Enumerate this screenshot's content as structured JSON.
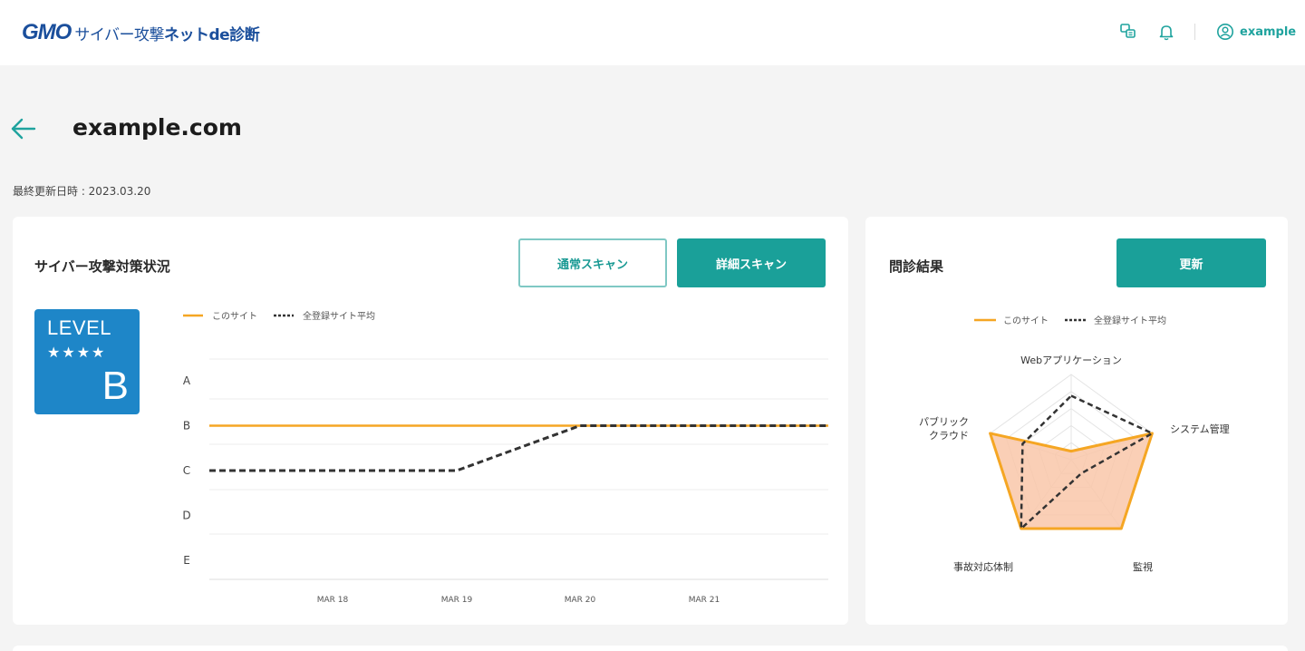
{
  "header": {
    "logo_brand": "GMO",
    "logo_regular": "サイバー攻撃",
    "logo_bold": "ネットde診断",
    "username": "example",
    "icons": [
      "notice-icon",
      "bell-icon",
      "user-icon"
    ]
  },
  "page": {
    "title": "example.com",
    "updated": "最終更新日時 : 2023.03.20"
  },
  "status_card": {
    "title": "サイバー攻撃対策状況",
    "normal_scan_label": "通常スキャン",
    "detail_scan_label": "詳細スキャン",
    "level": {
      "label": "LEVEL",
      "stars": "★★★★",
      "grade": "B"
    }
  },
  "result_card": {
    "title": "問診結果",
    "update_label": "更新"
  },
  "colors": {
    "accent": "#1aa099",
    "site_line": "#f5a623",
    "average_line": "#333333",
    "level_badge": "#1e86c8",
    "radar_fill": "#f9c7a9"
  },
  "chart_data": [
    {
      "type": "line",
      "legend": [
        "このサイト",
        "全登録サイト平均"
      ],
      "legend_position": "top-left",
      "y_categories": [
        "A",
        "B",
        "C",
        "D",
        "E"
      ],
      "x_ticks": [
        "MAR 18",
        "MAR 19",
        "MAR 20",
        "MAR 21"
      ],
      "grid": true,
      "series": [
        {
          "name": "このサイト",
          "style": "solid",
          "points": [
            [
              "MAR 17",
              "B"
            ],
            [
              "MAR 18",
              "B"
            ],
            [
              "MAR 19",
              "B"
            ],
            [
              "MAR 20",
              "B"
            ],
            [
              "MAR 21",
              "B"
            ],
            [
              "MAR 22",
              "B"
            ]
          ]
        },
        {
          "name": "全登録サイト平均",
          "style": "dashed",
          "points": [
            [
              "MAR 17",
              "C"
            ],
            [
              "MAR 18",
              "C"
            ],
            [
              "MAR 19",
              "C"
            ],
            [
              "MAR 20",
              "B"
            ],
            [
              "MAR 21",
              "B"
            ],
            [
              "MAR 22",
              "B"
            ]
          ]
        }
      ]
    },
    {
      "type": "radar",
      "legend": [
        "このサイト",
        "全登録サイト平均"
      ],
      "legend_position": "top-center",
      "axes": [
        "Webアプリケーション",
        "システム管理",
        "監視",
        "事故対応体制",
        "パブリック\nクラウド"
      ],
      "levels": 5,
      "series": [
        {
          "name": "このサイト",
          "style": "filled",
          "values": [
            0.1,
            1.0,
            1.0,
            1.0,
            1.0
          ]
        },
        {
          "name": "全登録サイト平均",
          "style": "dashed",
          "values": [
            0.75,
            1.0,
            0.2,
            1.0,
            0.6
          ]
        }
      ]
    }
  ]
}
